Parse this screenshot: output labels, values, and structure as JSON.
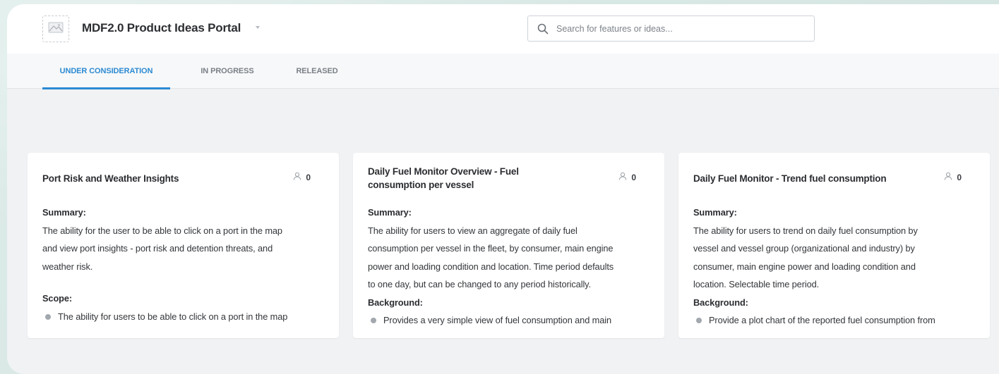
{
  "portal": {
    "title": "MDF2.0 Product Ideas Portal"
  },
  "search": {
    "placeholder": "Search for features or ideas..."
  },
  "tabs": [
    {
      "label": "UNDER CONSIDERATION",
      "active": true
    },
    {
      "label": "IN PROGRESS",
      "active": false
    },
    {
      "label": "RELEASED",
      "active": false
    }
  ],
  "colors": {
    "accent": "#2b8ad3",
    "frame": "#f0f2f4",
    "background": "#dbe9e6"
  },
  "cards": [
    {
      "title": "Port Risk and Weather Insights",
      "votes": "0",
      "summary_label": "Summary:",
      "summary_lines": [
        "The ability for the user to be able to click on a port in the map",
        "and view port insights - port risk and detention threats, and",
        "weather risk."
      ],
      "section2_label": "Scope:",
      "bullet": "The ability for users to be able to click on a port in the map"
    },
    {
      "title": "Daily Fuel Monitor Overview - Fuel consumption per vessel",
      "votes": "0",
      "summary_label": "Summary:",
      "summary_lines": [
        "The ability for users to view an aggregate of daily fuel",
        "consumption per vessel in the fleet, by consumer, main engine",
        "power and loading condition and location.  Time period defaults",
        "to one day, but can be changed to any period historically."
      ],
      "section2_label": "Background:",
      "bullet": "Provides a very simple view of fuel consumption and main"
    },
    {
      "title": "Daily Fuel Monitor - Trend fuel consumption",
      "votes": "0",
      "summary_label": "Summary:",
      "summary_lines": [
        "The ability for users to trend on daily fuel consumption by",
        "vessel and vessel group (organizational and industry) by",
        "consumer, main engine power and loading condition and",
        "location. Selectable time period."
      ],
      "section2_label": "Background:",
      "bullet": "Provide a plot chart of the reported fuel consumption from"
    }
  ]
}
